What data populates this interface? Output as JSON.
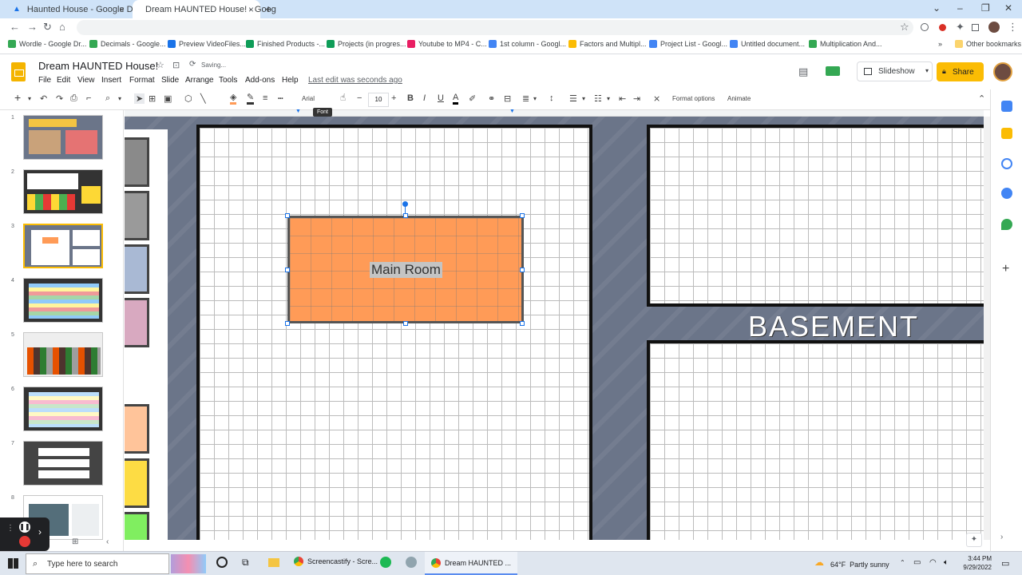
{
  "browser": {
    "tabs": [
      {
        "title": "Haunted House - Google Drive",
        "active": false
      },
      {
        "title": "Dream HAUNTED House! - Goog",
        "active": true
      }
    ],
    "bookmarks": [
      "Wordle - Google Dr...",
      "Decimals - Google...",
      "Preview VideoFiles...",
      "Finished Products -...",
      "Projects (in progres...",
      "Youtube to MP4 - C...",
      "1st column - Googl...",
      "Factors and Multipl...",
      "Project List - Googl...",
      "Untitled document...",
      "Multiplication And...",
      "Other bookmarks"
    ]
  },
  "app": {
    "title": "Dream HAUNTED House!",
    "status": "Saving...",
    "last_edit": "Last edit was seconds ago",
    "menu": [
      "File",
      "Edit",
      "View",
      "Insert",
      "Format",
      "Slide",
      "Arrange",
      "Tools",
      "Add-ons",
      "Help"
    ],
    "slideshow_label": "Slideshow",
    "share_label": "Share"
  },
  "toolbar": {
    "font": "Arial",
    "font_size": "10",
    "format_options": "Format options",
    "animate": "Animate",
    "tooltip": "Font"
  },
  "filmstrip": {
    "slide_numbers": [
      "1",
      "2",
      "3",
      "4",
      "5",
      "6",
      "7",
      "8"
    ],
    "selected": 3
  },
  "canvas": {
    "room_label": "Main Room",
    "section_basement": "BASEMENT"
  },
  "taskbar": {
    "search_placeholder": "Type here to search",
    "apps": [
      "Screencastify - Scre...",
      "Dream HAUNTED ..."
    ],
    "weather": "64°F  Partly sunny",
    "time": "3:44 PM",
    "date": "9/29/2022"
  },
  "colors": {
    "accent": "#fbbc04",
    "room_fill": "#ff9b57",
    "canvas_bg": "#6b7589"
  }
}
